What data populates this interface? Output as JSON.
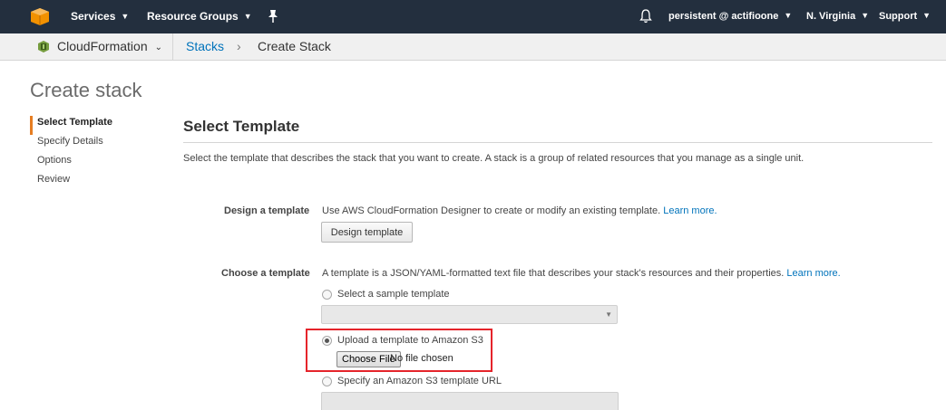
{
  "topnav": {
    "services_label": "Services",
    "resource_groups_label": "Resource Groups",
    "account_label": "persistent @ actifioone",
    "region_label": "N. Virginia",
    "support_label": "Support",
    "bg_color": "#232f3e",
    "logo_color": "#f29100"
  },
  "subnav": {
    "service_label": "CloudFormation",
    "breadcrumb": {
      "stacks": "Stacks",
      "separator": "›",
      "current": "Create Stack"
    }
  },
  "page": {
    "title": "Create stack"
  },
  "steps": [
    {
      "label": "Select Template",
      "active": true
    },
    {
      "label": "Specify Details",
      "active": false
    },
    {
      "label": "Options",
      "active": false
    },
    {
      "label": "Review",
      "active": false
    }
  ],
  "main": {
    "section_title": "Select Template",
    "description": "Select the template that describes the stack that you want to create. A stack is a group of related resources that you manage as a single unit.",
    "design": {
      "label": "Design a template",
      "text": "Use AWS CloudFormation Designer to create or modify an existing template.",
      "learn_more": "Learn more.",
      "button_label": "Design template"
    },
    "choose": {
      "label": "Choose a template",
      "text": "A template is a JSON/YAML-formatted text file that describes your stack's resources and their properties.",
      "learn_more": "Learn more.",
      "options": [
        {
          "label": "Select a sample template",
          "checked": false
        },
        {
          "label": "Upload a template to Amazon S3",
          "checked": true
        },
        {
          "label": "Specify an Amazon S3 template URL",
          "checked": false
        }
      ],
      "sample_select_value": "",
      "file_button_label": "Choose File",
      "file_status": "No file chosen",
      "url_value": ""
    }
  },
  "colors": {
    "link": "#0073bb",
    "active_step_accent": "#e67e22",
    "highlight_border": "#e5242b"
  }
}
